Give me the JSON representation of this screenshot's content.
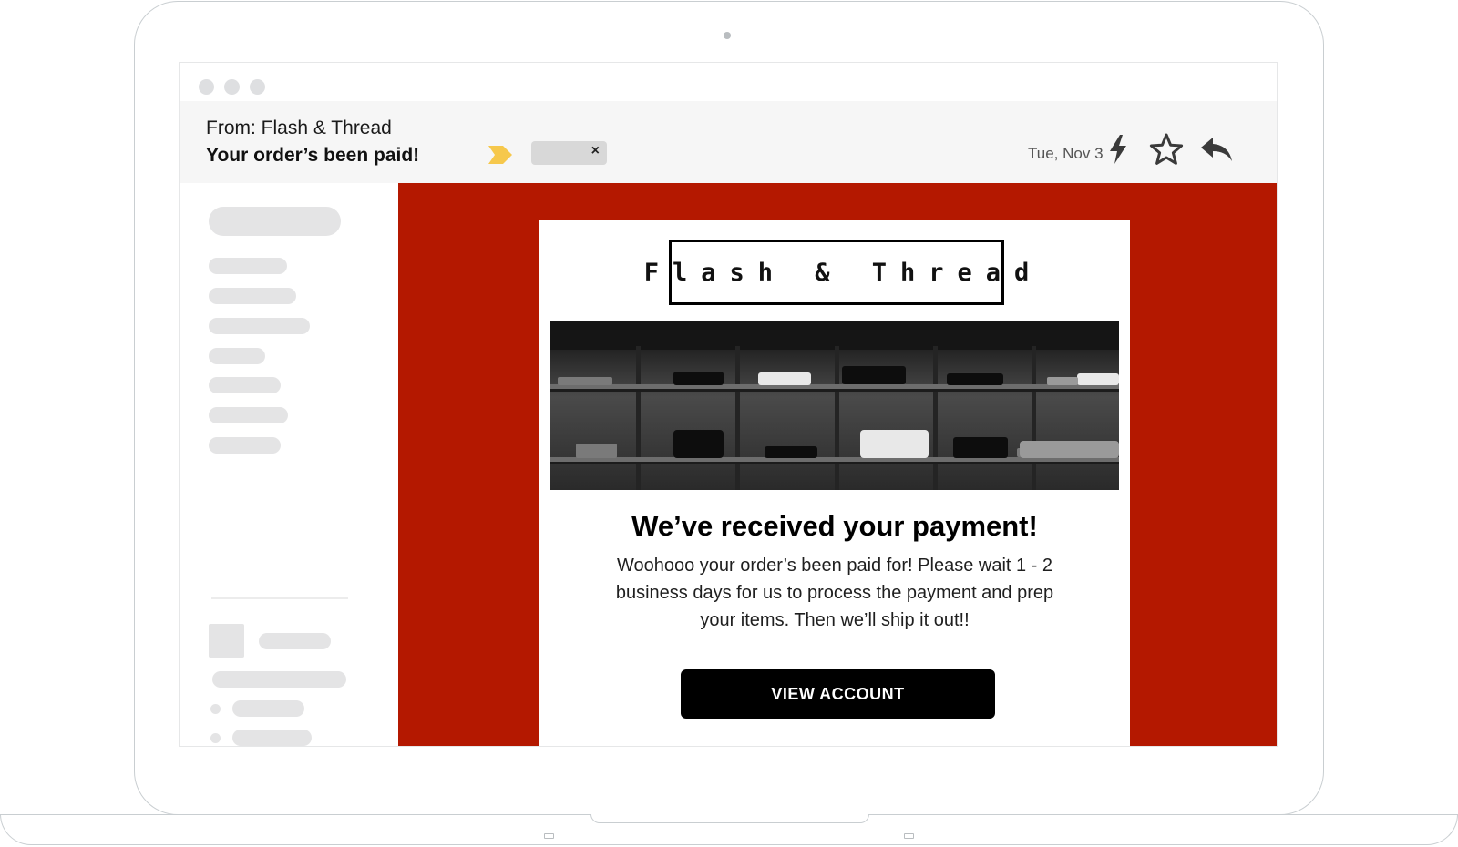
{
  "email": {
    "from_line": "From: Flash & Thread",
    "subject": "Your order’s been paid!",
    "date": "Tue, Nov 3"
  },
  "icons": {
    "tag": "tag-arrow-icon",
    "label_close": "close-icon",
    "lightning": "lightning-icon",
    "star": "star-icon",
    "reply": "reply-icon"
  },
  "label_chip": {
    "close_glyph": "×"
  },
  "message": {
    "logo": "Flash & Thread",
    "headline": "We’ve received your payment!",
    "body": "Woohooo your order’s been paid for! Please wait 1 - 2 business days for us to process the payment and prep your items. Then we’ll ship it out!!",
    "cta_label": "VIEW ACCOUNT"
  },
  "colors": {
    "email_background": "#b41800",
    "tag_arrow": "#f6c84c",
    "button": "#000000"
  }
}
